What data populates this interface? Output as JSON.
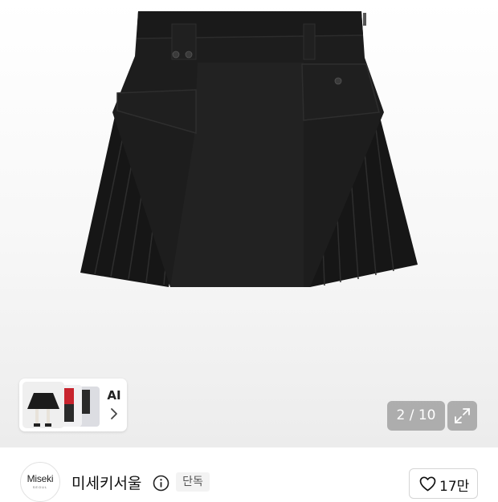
{
  "gallery": {
    "ai_label": "AI",
    "counter": "2 / 10"
  },
  "brand": {
    "logo_main": "Miseki",
    "logo_sub": "SEOUL",
    "name": "미세키서울",
    "badge": "단독"
  },
  "like": {
    "count": "17만"
  },
  "icons": [
    "chevron-right-icon",
    "expand-icon",
    "info-icon",
    "heart-icon"
  ],
  "colors": {
    "skirt": "#1c1c1c",
    "overlay_button": "#787878",
    "badge_bg": "#f3f3f3"
  }
}
